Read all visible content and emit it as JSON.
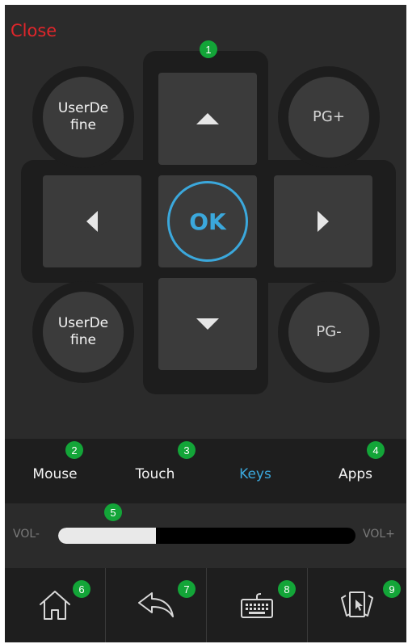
{
  "header": {
    "close_label": "Close"
  },
  "annotations": [
    "1",
    "2",
    "3",
    "4",
    "5",
    "6",
    "7",
    "8",
    "9"
  ],
  "dpad": {
    "ok_label": "OK",
    "up_icon": "triangle-up-icon",
    "down_icon": "triangle-down-icon",
    "left_icon": "triangle-left-icon",
    "right_icon": "triangle-right-icon"
  },
  "round_buttons": {
    "top_left": "UserDe fine",
    "bottom_left": "UserDe fine",
    "top_right": "PG+",
    "bottom_right": "PG-"
  },
  "tabs": [
    {
      "label": "Mouse",
      "active": false
    },
    {
      "label": "Touch",
      "active": false
    },
    {
      "label": "Keys",
      "active": true
    },
    {
      "label": "Apps",
      "active": false
    }
  ],
  "volume": {
    "minus_label": "VOL-",
    "plus_label": "VOL+",
    "level": 0.33
  },
  "bottom_bar": [
    {
      "icon": "home-icon"
    },
    {
      "icon": "back-icon"
    },
    {
      "icon": "keyboard-icon"
    },
    {
      "icon": "cards-icon"
    }
  ],
  "colors": {
    "accent": "#3ba8dc",
    "close": "#e0262b",
    "badge": "#13a538",
    "background": "#2b2b2b"
  }
}
